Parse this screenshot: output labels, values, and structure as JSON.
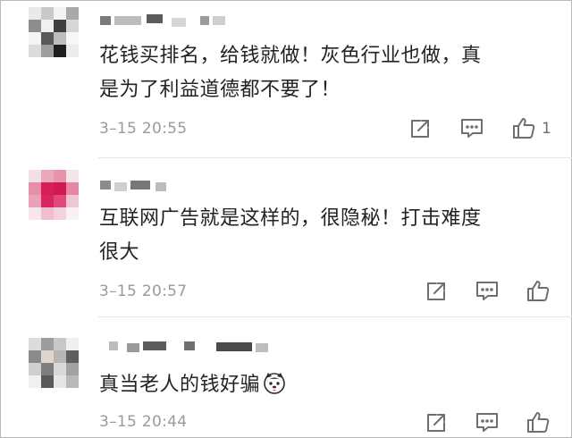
{
  "comments": [
    {
      "text_line1": "花钱买排名，给钱就做！灰色行业也做，真",
      "text_line2": "是为了利益道德都不要了！",
      "time": "3–15 20:55",
      "likes": "1"
    },
    {
      "text_line1": "互联网广告就是这样的，很隐秘！打击难度",
      "text_line2": "很大",
      "time": "3–15 20:57",
      "likes": ""
    },
    {
      "text_line1": "真当老人的钱好骗",
      "time": "3–15 20:44",
      "likes": "",
      "emoji": "husky-face-emoji"
    }
  ],
  "icons": {
    "repost": "repost-icon",
    "comment": "comment-icon",
    "like": "thumbs-up-icon"
  },
  "colors": {
    "text": "#222222",
    "meta": "#9a9a9a",
    "icon": "#6f6f6f",
    "divider": "#e6e6e6"
  }
}
